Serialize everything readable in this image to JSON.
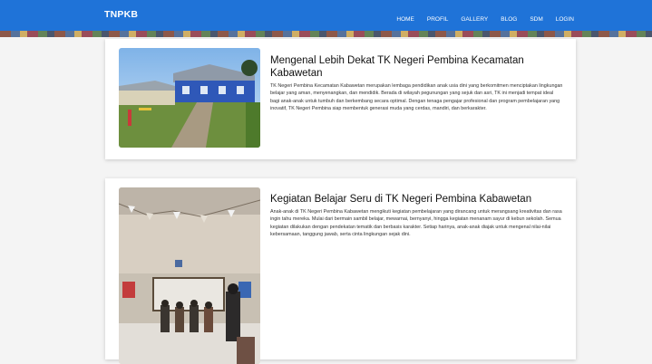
{
  "navbar": {
    "brand": "TNPKB",
    "items": [
      "HOME",
      "PROFIL",
      "GALLERY",
      "BLOG",
      "SDM",
      "LOGIN"
    ],
    "color": "#1f73d8"
  },
  "articles": [
    {
      "title": "Mengenal Lebih Dekat TK Negeri Pembina Kecamatan Kabawetan",
      "body": "TK Negeri Pembina Kecamatan Kabawetan merupakan lembaga pendidikan anak usia dini yang berkomitmen menciptakan lingkungan belajar yang aman, menyenangkan, dan mendidik. Berada di wilayah pegunungan yang sejuk dan asri, TK ini menjadi tempat ideal bagi anak-anak untuk tumbuh dan berkembang secara optimal. Dengan tenaga pengajar profesional dan program pembelajaran yang inovatif, TK Negeri Pembina siap membentuk generasi muda yang cerdas, mandiri, dan berkarakter."
    },
    {
      "title": "Kegiatan Belajar Seru di TK Negeri Pembina Kabawetan",
      "body": "Anak-anak di TK Negeri Pembina Kabawetan mengikuti kegiatan pembelajaran yang dirancang untuk merangsang kreativitas dan rasa ingin tahu mereka. Mulai dari bermain sambil belajar, mewarnai, bernyanyi, hingga kegiatan menanam sayur di kebun sekolah. Semua kegiatan dilakukan dengan pendekatan tematik dan berbasis karakter. Setiap harinya, anak-anak diajak untuk mengenal nilai-nilai kebersamaan, tanggung jawab, serta cinta lingkungan sejak dini."
    }
  ]
}
